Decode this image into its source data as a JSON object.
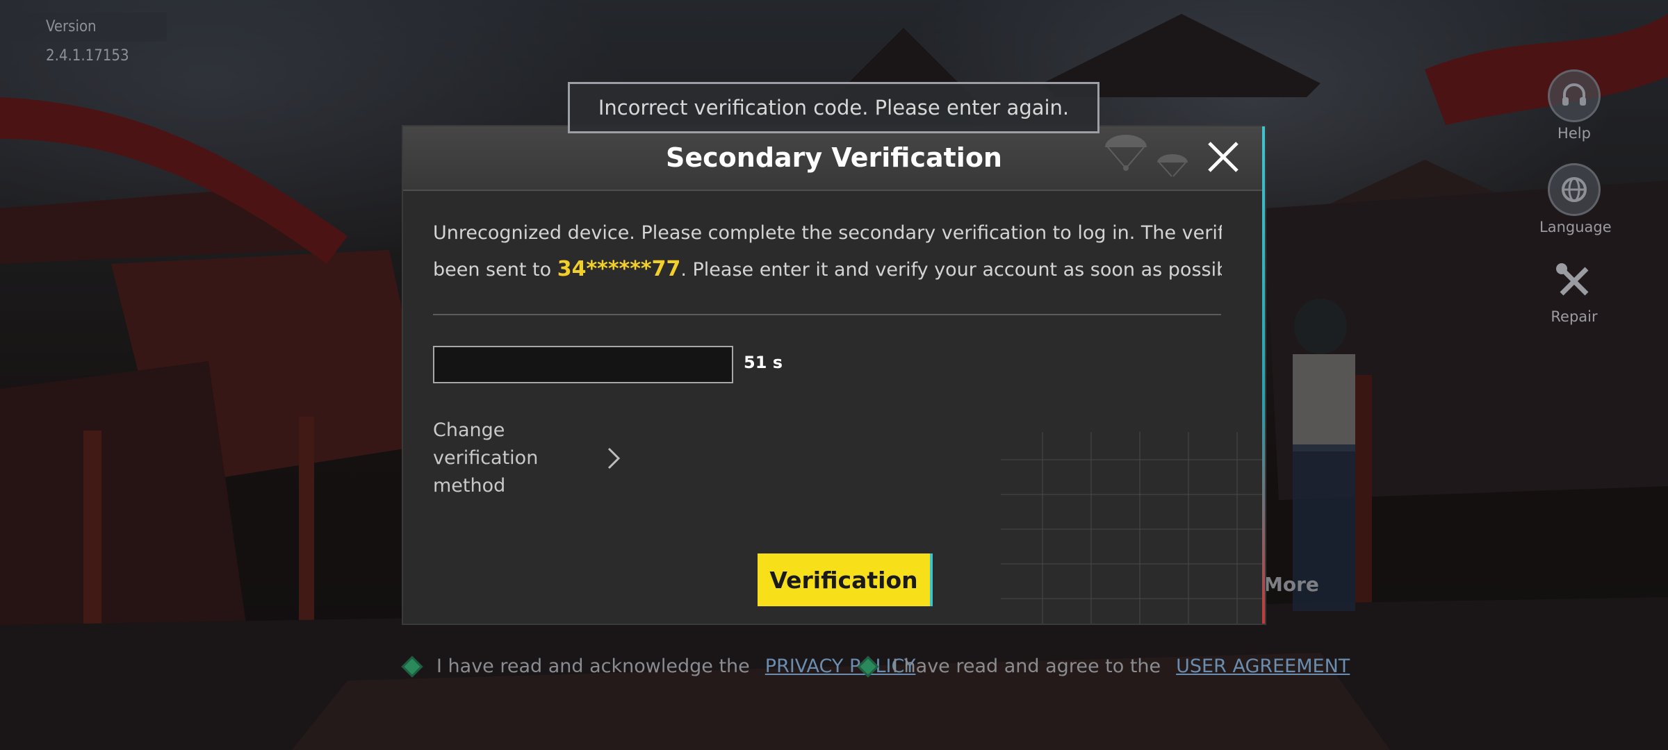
{
  "app": {
    "version": "Version 2.4.1.17153"
  },
  "side_menu": [
    {
      "label": "Help",
      "icon": "headset-icon"
    },
    {
      "label": "Language",
      "icon": "globe-icon"
    },
    {
      "label": "Repair",
      "icon": "wrench-screwdriver-icon"
    }
  ],
  "more_label": "More",
  "agreements": {
    "privacy_text": "I have read and acknowledge the",
    "privacy_link": "PRIVACY POLICY",
    "user_text": "I have read and agree to the",
    "user_link": "USER AGREEMENT"
  },
  "toast": {
    "message": "Incorrect verification code. Please enter again."
  },
  "dialog": {
    "title": "Secondary Verification",
    "message_part1": "Unrecognized device. Please complete the secondary verification to log in. The verification code has",
    "message_part2_prefix": "been sent to",
    "phone_masked": "34******77",
    "message_part2_suffix": ". Please enter it and verify your account as soon as possible.",
    "code_input": {
      "value": "",
      "placeholder": ""
    },
    "countdown": "51 s",
    "change_method_label": "Change verification method",
    "verify_button": "Verification"
  },
  "colors": {
    "accent_yellow": "#f7e01a",
    "phone_highlight": "#f3cf2a",
    "accent_cyan": "#3fc4cf"
  }
}
